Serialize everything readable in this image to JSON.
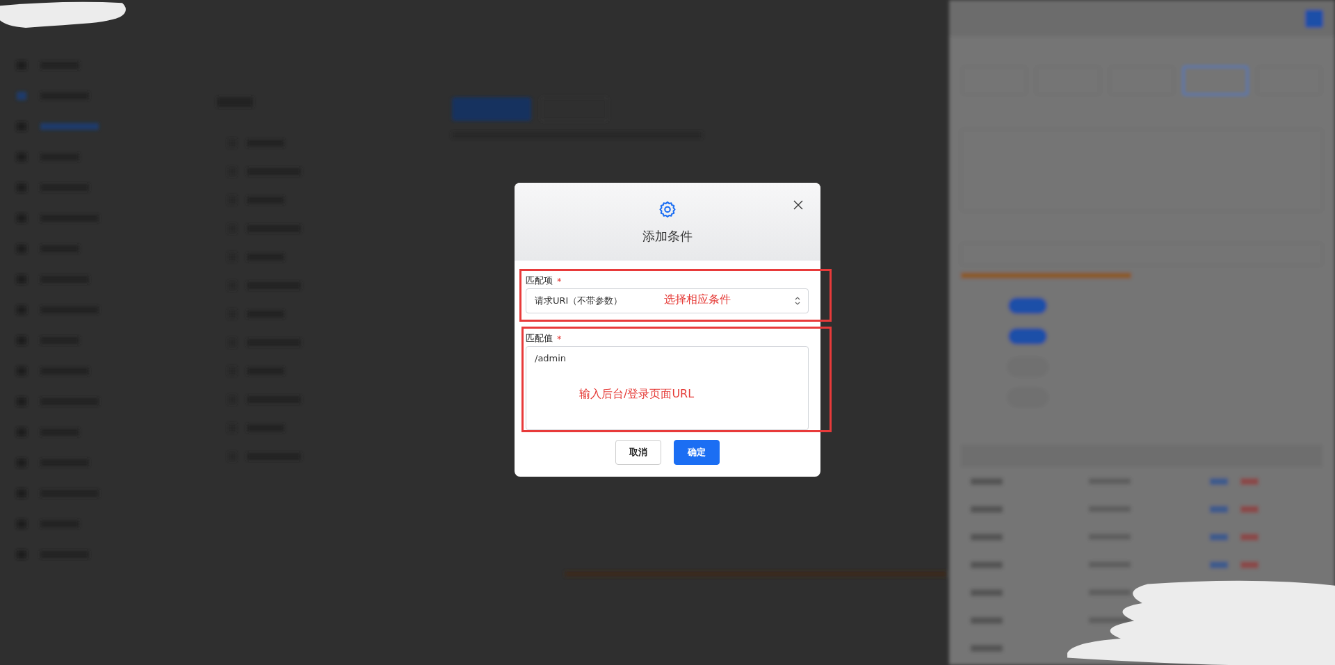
{
  "background": {
    "kind": "blurred_page"
  },
  "redactions": [
    {
      "kind": "scribble"
    },
    {
      "kind": "scribble"
    }
  ],
  "dialog": {
    "title": "添加条件",
    "fields": [
      {
        "kind": "select",
        "label": "匹配项",
        "required_mark": "*",
        "value": "请求URI（不带参数）",
        "annotation": "选择相应条件"
      },
      {
        "kind": "textarea",
        "label": "匹配值",
        "required_mark": "*",
        "value": "/admin",
        "annotation": "输入后台/登录页面URL"
      }
    ],
    "buttons": [
      {
        "kind": "secondary",
        "label": "取消"
      },
      {
        "kind": "primary",
        "label": "确定"
      }
    ]
  }
}
